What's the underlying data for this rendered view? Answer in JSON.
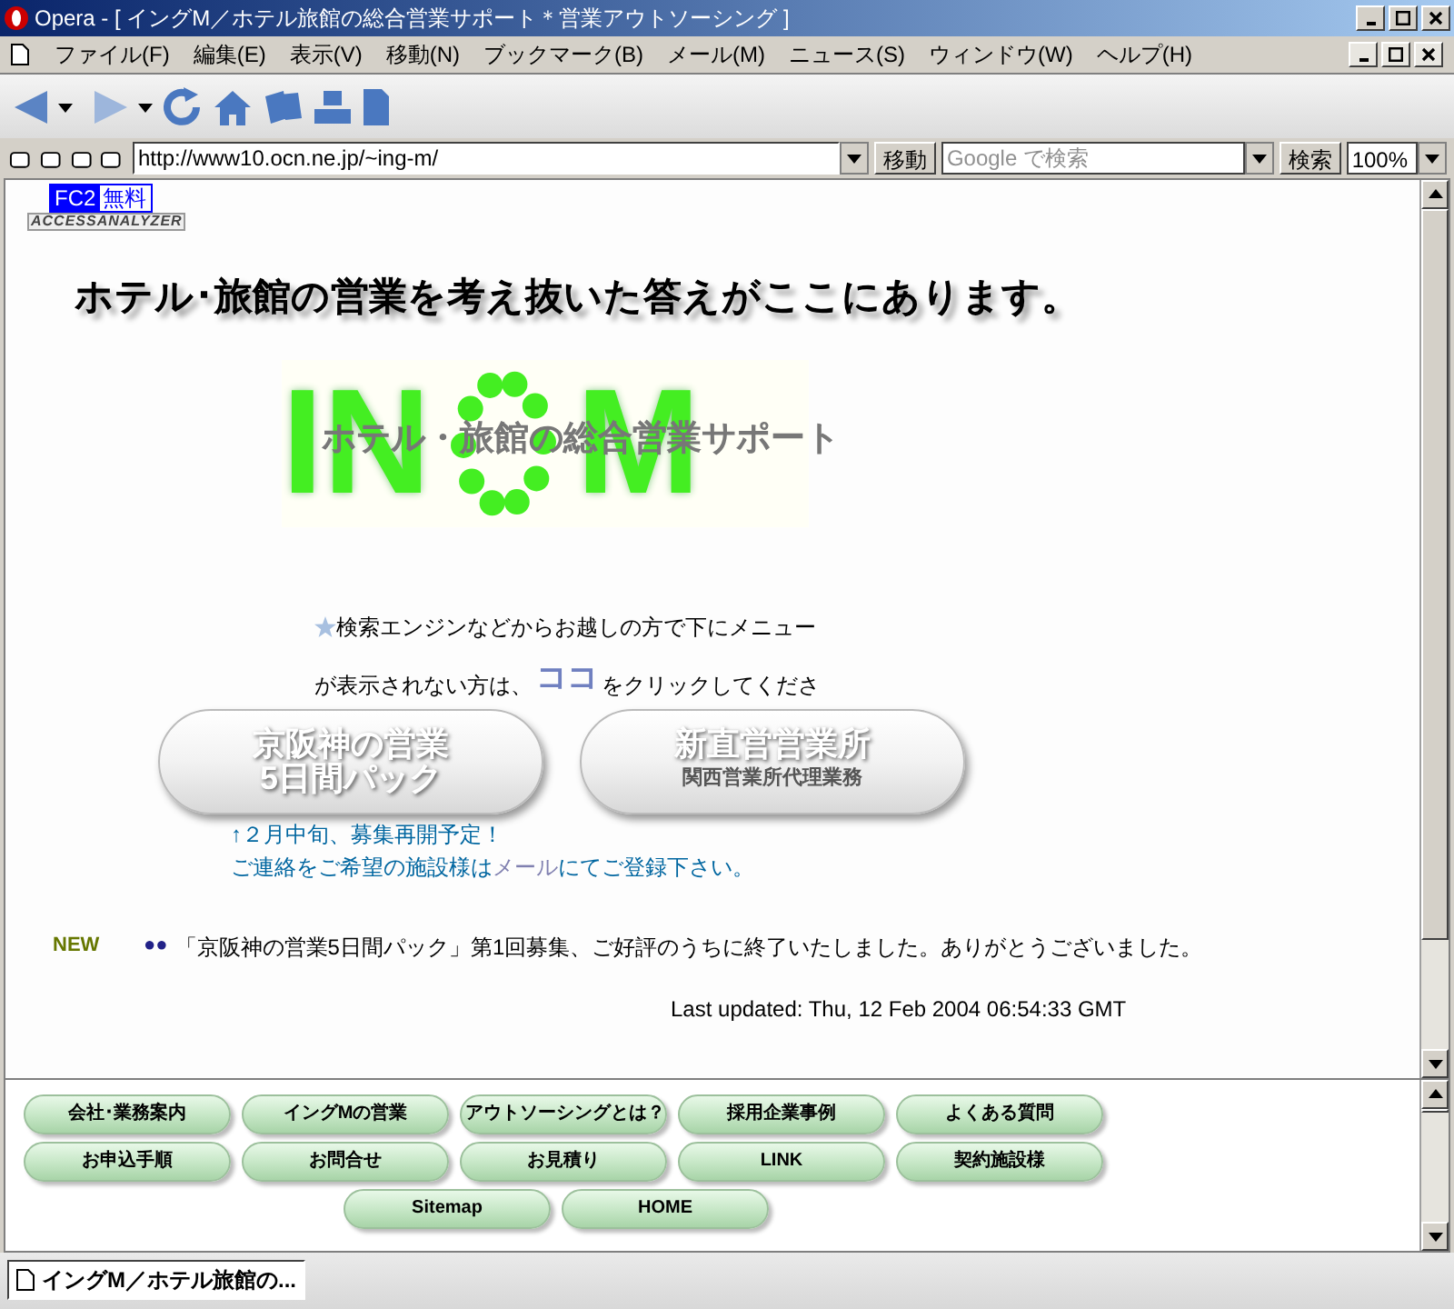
{
  "window": {
    "title": "Opera - [ イングM／ホテル旅館の総合営業サポート＊営業アウトソーシング ]"
  },
  "menu": [
    "ファイル(F)",
    "編集(E)",
    "表示(V)",
    "移動(N)",
    "ブックマーク(B)",
    "メール(M)",
    "ニュース(S)",
    "ウィンドウ(W)",
    "ヘルプ(H)"
  ],
  "address_bar": {
    "url": "http://www10.ocn.ne.jp/~ing-m/",
    "go_button": "移動",
    "search_placeholder": "Google で検索",
    "search_button": "検索",
    "zoom": "100%"
  },
  "page": {
    "counter_badge": [
      "FC2",
      "無料"
    ],
    "analyzer_logo": "ACCESSANALYZER",
    "headline": "ホテル･旅館の営業を考え抜いた答えがここにあります。",
    "logo": {
      "left": "IN",
      "right": "M",
      "overlay": "ホテル・旅館の総合営業サポート"
    },
    "notice": {
      "line_1": "検索エンジンなどからお越しの方で下にメニュー",
      "line_2_before": "が表示されない方は、",
      "link": "ココ",
      "line_2_after": "をクリックしてくださ"
    },
    "feature_buttons": [
      {
        "lines": [
          "京阪神の営業",
          "5日間パック"
        ]
      },
      {
        "lines": [
          "新直営営業所",
          "関西営業所代理業務"
        ]
      }
    ],
    "recruit_note": {
      "line_1": "↑２月中旬、募集再開予定！",
      "line_2_before": "ご連絡をご希望の施設様は",
      "link": "メール",
      "line_2_after": "にてご登録下さい。"
    },
    "news": {
      "badge": "NEW",
      "bullet": "●●",
      "text": "「京阪神の営業5日間パック」第1回募集、ご好評のうちに終了いたしました。ありがとうございました。"
    },
    "last_updated": "Last updated: Thu, 12 Feb 2004 06:54:33 GMT"
  },
  "nav_rows": [
    [
      "会社･業務案内",
      "イングMの営業",
      "アウトソーシングとは？",
      "採用企業事例",
      "よくある質問"
    ],
    [
      "お申込手順",
      "お問合せ",
      "お見積り",
      "LINK",
      "契約施設様"
    ],
    [
      "Sitemap",
      "HOME"
    ]
  ],
  "tabs": [
    {
      "label": "イングM／ホテル旅館の...",
      "selected": true
    }
  ]
}
